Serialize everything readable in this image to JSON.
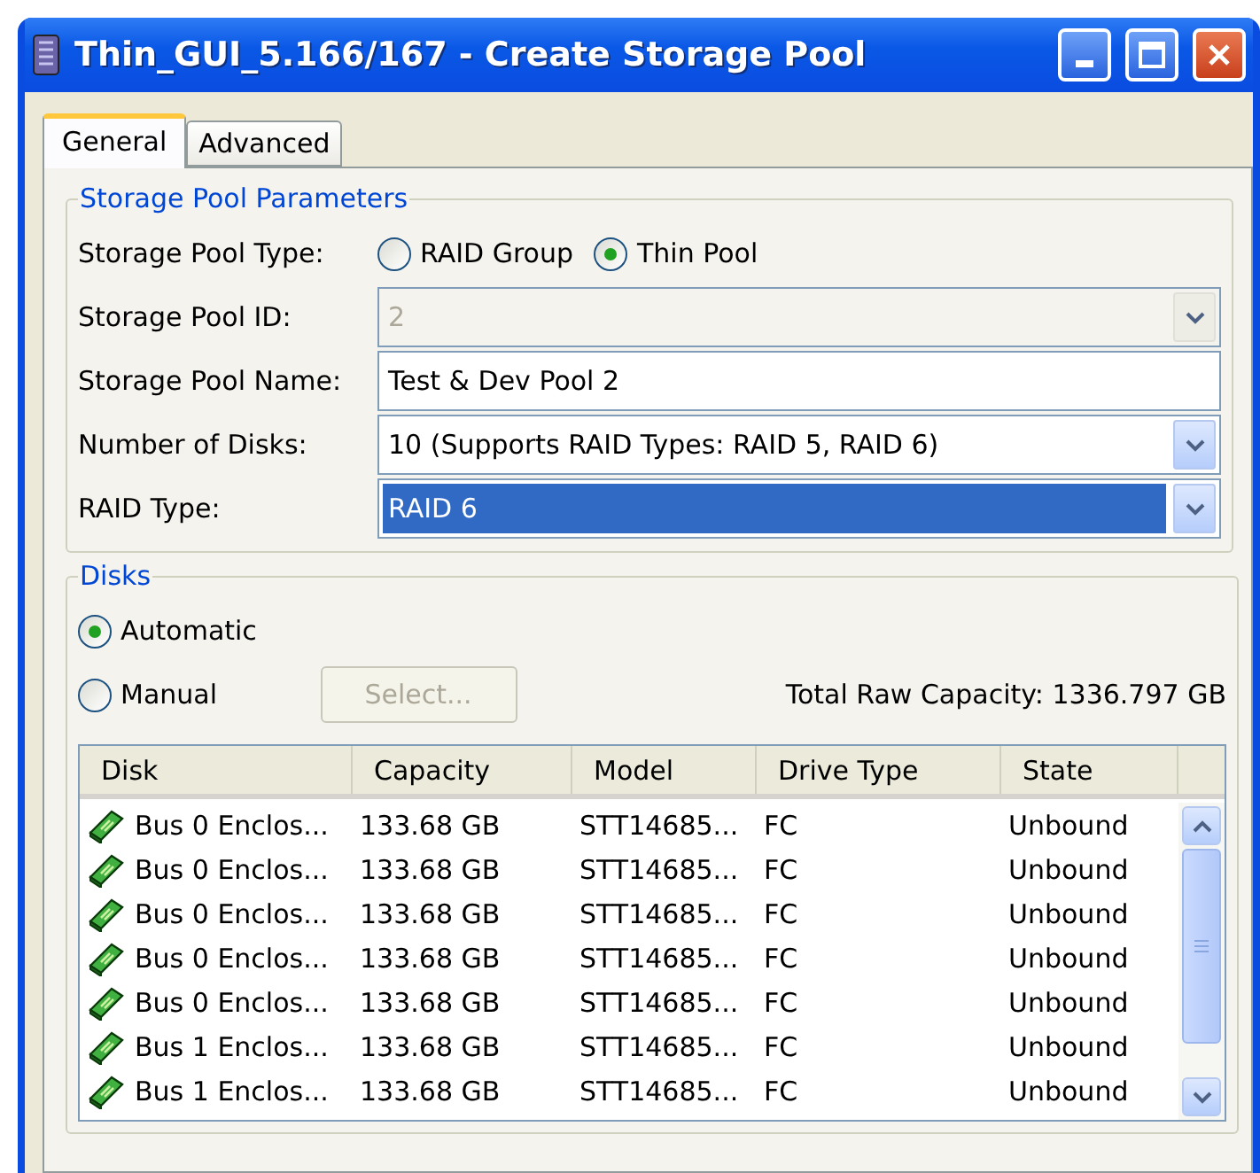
{
  "window": {
    "title": "Thin_GUI_5.166/167 - Create Storage Pool"
  },
  "tabs": [
    {
      "label": "General",
      "selected": true
    },
    {
      "label": "Advanced",
      "selected": false
    }
  ],
  "parameters": {
    "title": "Storage Pool Parameters",
    "pool_type": {
      "label": "Storage Pool Type:",
      "options": [
        {
          "label": "RAID Group",
          "selected": false
        },
        {
          "label": "Thin Pool",
          "selected": true
        }
      ]
    },
    "fields": [
      {
        "label": "Storage Pool ID:",
        "kind": "combo",
        "value": "2",
        "disabled": true,
        "highlighted": false
      },
      {
        "label": "Storage Pool Name:",
        "kind": "text",
        "value": "Test & Dev Pool 2",
        "disabled": false,
        "highlighted": false
      },
      {
        "label": "Number of Disks:",
        "kind": "combo",
        "value": "10 (Supports RAID Types: RAID 5, RAID 6)",
        "disabled": false,
        "highlighted": false
      },
      {
        "label": "RAID Type:",
        "kind": "combo",
        "value": "RAID 6",
        "disabled": false,
        "highlighted": true
      }
    ]
  },
  "disks": {
    "title": "Disks",
    "modes": [
      {
        "label": "Automatic",
        "selected": true
      },
      {
        "label": "Manual",
        "selected": false
      }
    ],
    "select_button": {
      "label": "Select...",
      "disabled": true
    },
    "total": "Total Raw Capacity: 1336.797 GB",
    "table": {
      "columns": [
        "Disk",
        "Capacity",
        "Model",
        "Drive Type",
        "State"
      ],
      "rows": [
        [
          "Bus 0 Enclos...",
          "133.68 GB",
          "STT14685...",
          "FC",
          "Unbound"
        ],
        [
          "Bus 0 Enclos...",
          "133.68 GB",
          "STT14685...",
          "FC",
          "Unbound"
        ],
        [
          "Bus 0 Enclos...",
          "133.68 GB",
          "STT14685...",
          "FC",
          "Unbound"
        ],
        [
          "Bus 0 Enclos...",
          "133.68 GB",
          "STT14685...",
          "FC",
          "Unbound"
        ],
        [
          "Bus 0 Enclos...",
          "133.68 GB",
          "STT14685...",
          "FC",
          "Unbound"
        ],
        [
          "Bus 1 Enclos...",
          "133.68 GB",
          "STT14685...",
          "FC",
          "Unbound"
        ],
        [
          "Bus 1 Enclos...",
          "133.68 GB",
          "STT14685...",
          "FC",
          "Unbound"
        ]
      ]
    }
  }
}
